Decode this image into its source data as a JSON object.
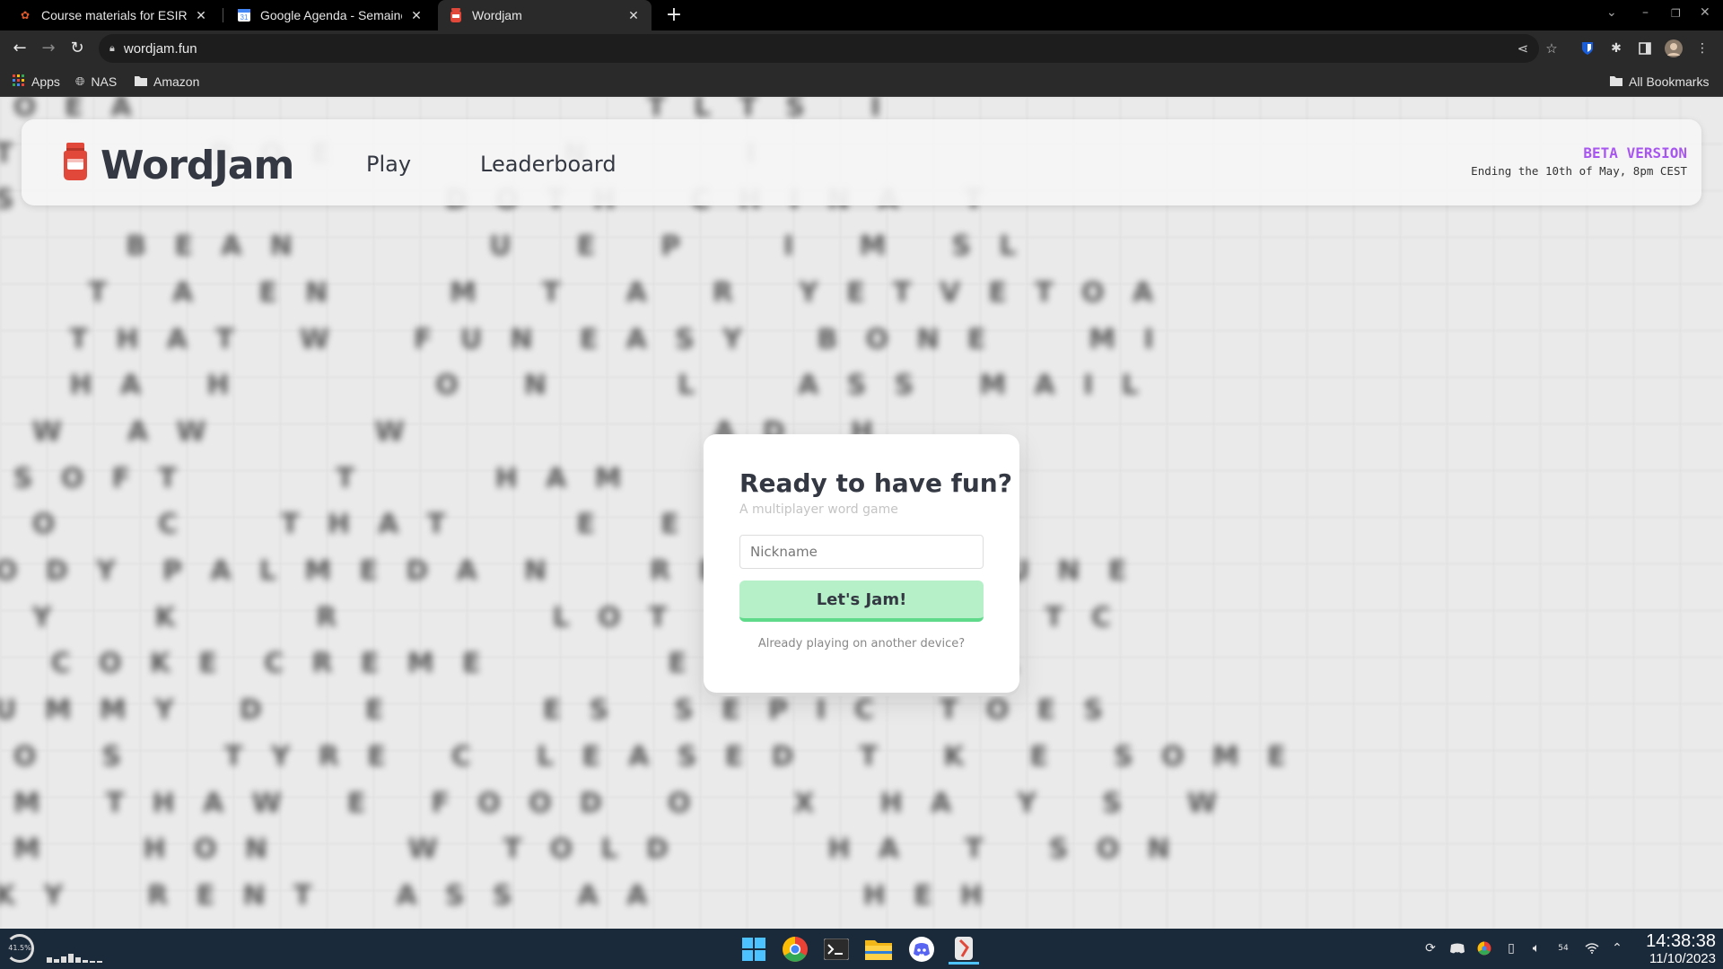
{
  "browser": {
    "tabs": [
      {
        "title": "Course materials for ESIR3 s",
        "active": false
      },
      {
        "title": "Google Agenda - Semaine d",
        "active": false
      },
      {
        "title": "Wordjam",
        "active": true
      }
    ],
    "url": "wordjam.fun",
    "bookmarks": [
      {
        "label": "Apps",
        "icon": "apps-grid-icon"
      },
      {
        "label": "NAS",
        "icon": "globe-icon"
      },
      {
        "label": "Amazon",
        "icon": "folder-icon"
      }
    ],
    "all_bookmarks": "All Bookmarks"
  },
  "site": {
    "logo_text": "WordJam",
    "nav": {
      "play": "Play",
      "leaderboard": "Leaderboard"
    },
    "beta_title": "BETA VERSION",
    "beta_subtitle": "Ending the 10th of May, 8pm CEST",
    "accent_color": "#a856f0"
  },
  "modal": {
    "title": "Ready to have fun?",
    "subtitle": "A multiplayer word game",
    "nickname_placeholder": "Nickname",
    "button_label": "Let's Jam!",
    "other_device": "Already playing on another device?",
    "button_color": "#b5f0c8"
  },
  "background_rows": [
    "  O   E   A                                                       T   L   T   S       I",
    "T                     D   O   E                         N                 I",
    "S                                              D   O   T   H        C   H   I   N   A       T",
    "              B   E   A   N                     U       E       P           I       M       S   L",
    "          T       A       E   N             M       T       A       R       Y   E   T   V   E   T   O   A",
    "        T   H   A   T       W         F   U   N     E   A   S   Y        B   O   N   E           M   I",
    "        H   A       H                      O       N              L           A   S   S       M   A   I   L",
    "    W       A   W                  W                                 A   D       H",
    "  S   O   F   T                 T               H   A   M               M   I   L   K   S",
    "    O           C           T   H   A   T              E       E           I               P",
    "O   D   Y     P   A   L   M   E   D   A     N           R   E   D           N       R   U   N   E",
    "    Y           K               R                       L   O   T       L   E   E   R       U       T   C",
    "      C   O   K   E     C   R   E   M   E                    E           U           A       L",
    "U   M   M   Y       D           E                 E   S       S   E   P   I   C       T   O   E   S",
    "  O       S           T   Y   R   E       C       L   E   A   S   E   D       T       K       E       S   O   M   E",
    "  M       T   H   A   W       E       F   O   O   D       O           X       H   A       Y       S       W",
    "  M           H   O   N               W       T   O   L   D                 H   A       T       S   O   N",
    "K   Y         R   E   N   T         A   S   S       A   A                       H   E   H"
  ],
  "taskbar": {
    "cpu_percent": "41.5%",
    "battery": "54",
    "time": "14:38:38",
    "date": "11/10/2023",
    "apps": [
      "start-icon",
      "chrome-icon",
      "terminal-icon",
      "file-explorer-icon",
      "discord-icon",
      "git-client-icon"
    ]
  }
}
